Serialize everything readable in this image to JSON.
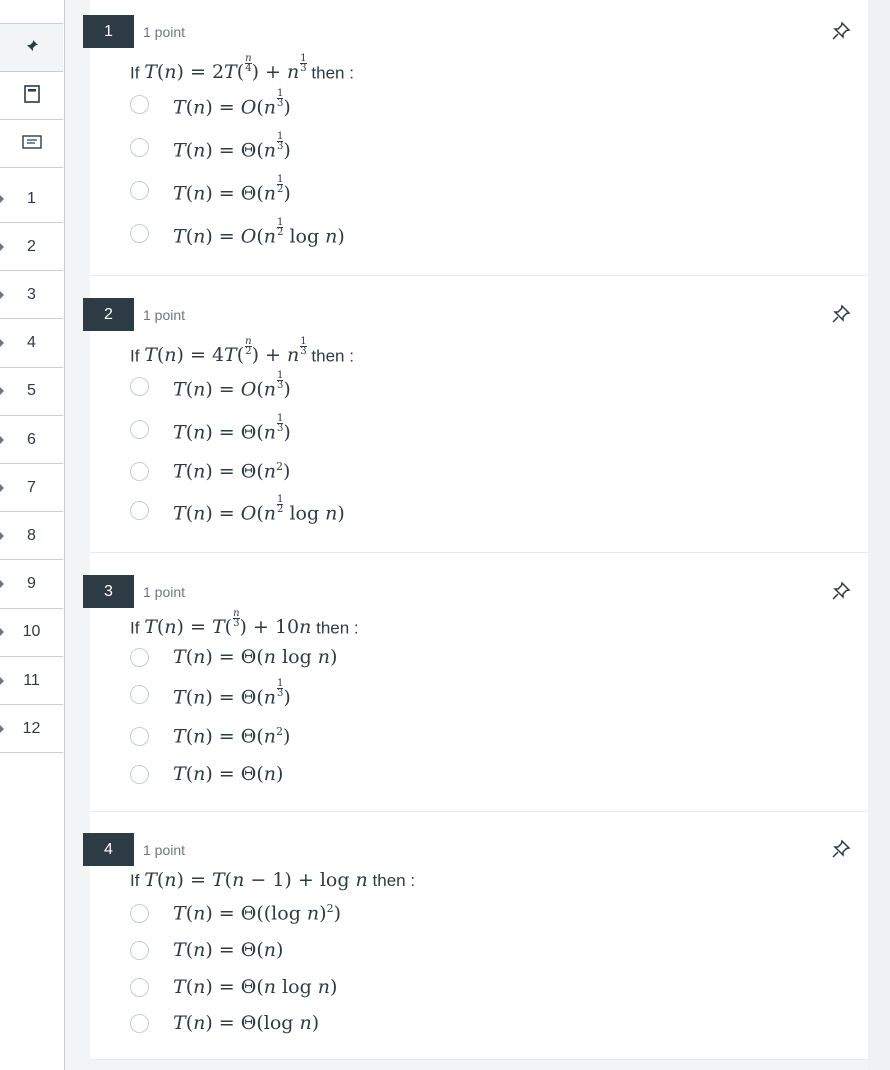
{
  "sidebar": {
    "numbers": [
      "1",
      "2",
      "3",
      "4",
      "5",
      "6",
      "7",
      "8",
      "9",
      "10",
      "11",
      "12"
    ]
  },
  "colors": {
    "accent": "#2d3b45",
    "border": "#c7cdd1"
  },
  "questions": [
    {
      "number": "1",
      "points": "1 point",
      "stem_prefix": "If",
      "stem_math": "T(n) = 2T(n/4) + n^(1/3)",
      "stem_suffix": "then :",
      "answers": [
        "T(n) = O(n^(1/3))",
        "T(n) = Θ(n^(1/3))",
        "T(n) = Θ(n^(1/2))",
        "T(n) = O(n^(1/2) log n)"
      ]
    },
    {
      "number": "2",
      "points": "1 point",
      "stem_prefix": "If",
      "stem_math": "T(n) = 4T(n/2) + n^(1/3)",
      "stem_suffix": "then :",
      "answers": [
        "T(n) = O(n^(1/3))",
        "T(n) = Θ(n^(1/3))",
        "T(n) = Θ(n^2)",
        "T(n) = O(n^(1/2) log n)"
      ]
    },
    {
      "number": "3",
      "points": "1 point",
      "stem_prefix": "If",
      "stem_math": "T(n) = T(n/3) + 10n",
      "stem_suffix": "then :",
      "answers": [
        "T(n) = Θ(n log n)",
        "T(n) = Θ(n^(1/3))",
        "T(n) = Θ(n^2)",
        "T(n) = Θ(n)"
      ]
    },
    {
      "number": "4",
      "points": "1 point",
      "stem_prefix": "If",
      "stem_math": "T(n) = T(n − 1) + log n",
      "stem_suffix": "then :",
      "answers": [
        "T(n) = Θ((log n)^2)",
        "T(n) = Θ(n)",
        "T(n) = Θ(n log n)",
        "T(n) = Θ(log n)"
      ]
    }
  ]
}
